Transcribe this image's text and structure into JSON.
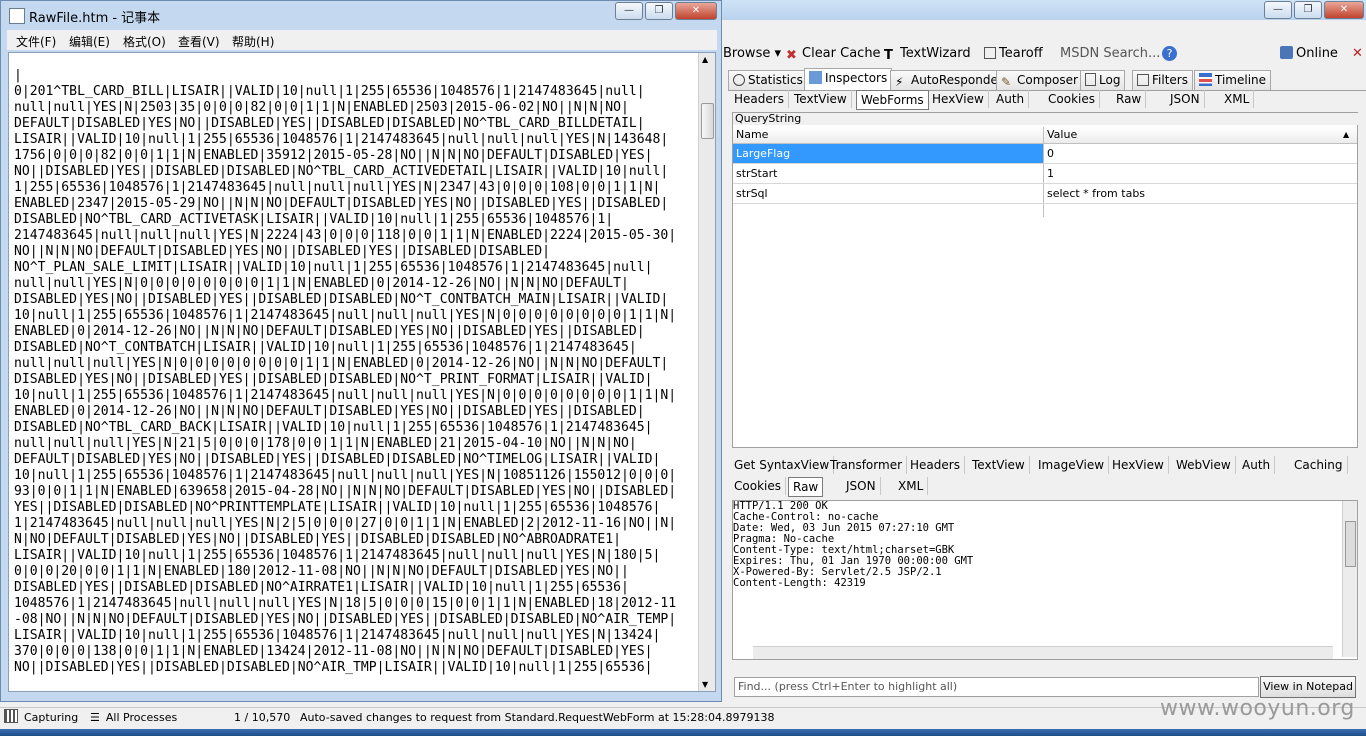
{
  "notepad": {
    "title": "RawFile.htm - 记事本",
    "menu": [
      "文件(F)",
      "编辑(E)",
      "格式(O)",
      "查看(V)",
      "帮助(H)"
    ],
    "lines": [
      "|",
      "0|201^TBL_CARD_BILL|LISAIR||VALID|10|null|1|255|65536|1048576|1|2147483645|null|",
      "null|null|YES|N|2503|35|0|0|0|82|0|0|1|1|N|ENABLED|2503|2015-06-02|NO||N|N|NO|",
      "DEFAULT|DISABLED|YES|NO||DISABLED|YES||DISABLED|DISABLED|NO^TBL_CARD_BILLDETAIL|",
      "LISAIR||VALID|10|null|1|255|65536|1048576|1|2147483645|null|null|null|YES|N|143648|",
      "1756|0|0|0|82|0|0|1|1|N|ENABLED|35912|2015-05-28|NO||N|N|NO|DEFAULT|DISABLED|YES|",
      "NO||DISABLED|YES||DISABLED|DISABLED|NO^TBL_CARD_ACTIVEDETAIL|LISAIR||VALID|10|null|",
      "1|255|65536|1048576|1|2147483645|null|null|null|YES|N|2347|43|0|0|0|108|0|0|1|1|N|",
      "ENABLED|2347|2015-05-29|NO||N|N|NO|DEFAULT|DISABLED|YES|NO||DISABLED|YES||DISABLED|",
      "DISABLED|NO^TBL_CARD_ACTIVETASK|LISAIR||VALID|10|null|1|255|65536|1048576|1|",
      "2147483645|null|null|null|YES|N|2224|43|0|0|0|118|0|0|1|1|N|ENABLED|2224|2015-05-30|",
      "NO||N|N|NO|DEFAULT|DISABLED|YES|NO||DISABLED|YES||DISABLED|DISABLED|",
      "NO^T_PLAN_SALE_LIMIT|LISAIR||VALID|10|null|1|255|65536|1048576|1|2147483645|null|",
      "null|null|YES|N|0|0|0|0|0|0|0|0|1|1|N|ENABLED|0|2014-12-26|NO||N|N|NO|DEFAULT|",
      "DISABLED|YES|NO||DISABLED|YES||DISABLED|DISABLED|NO^T_CONTBATCH_MAIN|LISAIR||VALID|",
      "10|null|1|255|65536|1048576|1|2147483645|null|null|null|YES|N|0|0|0|0|0|0|0|0|1|1|N|",
      "ENABLED|0|2014-12-26|NO||N|N|NO|DEFAULT|DISABLED|YES|NO||DISABLED|YES||DISABLED|",
      "DISABLED|NO^T_CONTBATCH|LISAIR||VALID|10|null|1|255|65536|1048576|1|2147483645|",
      "null|null|null|YES|N|0|0|0|0|0|0|0|0|1|1|N|ENABLED|0|2014-12-26|NO||N|N|NO|DEFAULT|",
      "DISABLED|YES|NO||DISABLED|YES||DISABLED|DISABLED|NO^T_PRINT_FORMAT|LISAIR||VALID|",
      "10|null|1|255|65536|1048576|1|2147483645|null|null|null|YES|N|0|0|0|0|0|0|0|0|1|1|N|",
      "ENABLED|0|2014-12-26|NO||N|N|NO|DEFAULT|DISABLED|YES|NO||DISABLED|YES||DISABLED|",
      "DISABLED|NO^TBL_CARD_BACK|LISAIR||VALID|10|null|1|255|65536|1048576|1|2147483645|",
      "null|null|null|YES|N|21|5|0|0|0|178|0|0|1|1|N|ENABLED|21|2015-04-10|NO||N|N|NO|",
      "DEFAULT|DISABLED|YES|NO||DISABLED|YES||DISABLED|DISABLED|NO^TIMELOG|LISAIR||VALID|",
      "10|null|1|255|65536|1048576|1|2147483645|null|null|null|YES|N|10851126|155012|0|0|0|",
      "93|0|0|1|1|N|ENABLED|639658|2015-04-28|NO||N|N|NO|DEFAULT|DISABLED|YES|NO||DISABLED|",
      "YES||DISABLED|DISABLED|NO^PRINTTEMPLATE|LISAIR||VALID|10|null|1|255|65536|1048576|",
      "1|2147483645|null|null|null|YES|N|2|5|0|0|0|27|0|0|1|1|N|ENABLED|2|2012-11-16|NO||N|",
      "N|NO|DEFAULT|DISABLED|YES|NO||DISABLED|YES||DISABLED|DISABLED|NO^ABROADRATE1|",
      "LISAIR||VALID|10|null|1|255|65536|1048576|1|2147483645|null|null|null|YES|N|180|5|",
      "0|0|0|20|0|0|1|1|N|ENABLED|180|2012-11-08|NO||N|N|NO|DEFAULT|DISABLED|YES|NO||",
      "DISABLED|YES||DISABLED|DISABLED|NO^AIRRATE1|LISAIR||VALID|10|null|1|255|65536|",
      "1048576|1|2147483645|null|null|null|YES|N|18|5|0|0|0|15|0|0|1|1|N|ENABLED|18|2012-11",
      "-08|NO||N|N|NO|DEFAULT|DISABLED|YES|NO||DISABLED|YES||DISABLED|DISABLED|NO^AIR_TEMP|",
      "LISAIR||VALID|10|null|1|255|65536|1048576|1|2147483645|null|null|null|YES|N|13424|",
      "370|0|0|0|138|0|0|1|1|N|ENABLED|13424|2012-11-08|NO||N|N|NO|DEFAULT|DISABLED|YES|",
      "NO||DISABLED|YES||DISABLED|DISABLED|NO^AIR_TMP|LISAIR||VALID|10|null|1|255|65536|"
    ]
  },
  "fiddler": {
    "toolbar": {
      "browse": "Browse",
      "clear_cache": "Clear Cache",
      "textwizard": "TextWizard",
      "tearoff": "Tearoff",
      "msdn_search": "MSDN Search...",
      "online": "Online"
    },
    "main_tabs": [
      "Statistics",
      "Inspectors",
      "AutoResponder",
      "Composer",
      "Log",
      "Filters",
      "Timeline"
    ],
    "request_tabs": [
      "Headers",
      "TextView",
      "WebForms",
      "HexView",
      "Auth",
      "Cookies",
      "Raw",
      "JSON",
      "XML"
    ],
    "querystring_label": "QueryString",
    "grid_headers": {
      "name": "Name",
      "value": "Value"
    },
    "query_rows": [
      {
        "name": "LargeFlag",
        "value": "0"
      },
      {
        "name": "strStart",
        "value": "1"
      },
      {
        "name": "strSql",
        "value": "select * from tabs"
      }
    ],
    "response_tabs_row1": [
      "Get SyntaxView",
      "Transformer",
      "Headers",
      "TextView",
      "ImageView",
      "HexView",
      "WebView",
      "Auth",
      "Caching"
    ],
    "response_tabs_row2": [
      "Cookies",
      "Raw",
      "JSON",
      "XML"
    ],
    "response_lines": [
      "HTTP/1.1 200 OK",
      "Cache-Control: no-cache",
      "Date: Wed, 03 Jun 2015 07:27:10 GMT",
      "Pragma: No-cache",
      "Content-Type: text/html;charset=GBK",
      "Expires: Thu, 01 Jan 1970 00:00:00 GMT",
      "X-Powered-By: Servlet/2.5 JSP/2.1",
      "Content-Length: 42319"
    ],
    "find_placeholder": "Find... (press Ctrl+Enter to highlight all)",
    "view_in_notepad": "View in Notepad"
  },
  "status": {
    "capturing": "Capturing",
    "processes": "All Processes",
    "count": "1 / 10,570",
    "message": "Auto-saved changes to request from Standard.RequestWebForm at 15:28:04.8979138"
  },
  "watermark": "www.wooyun.org"
}
